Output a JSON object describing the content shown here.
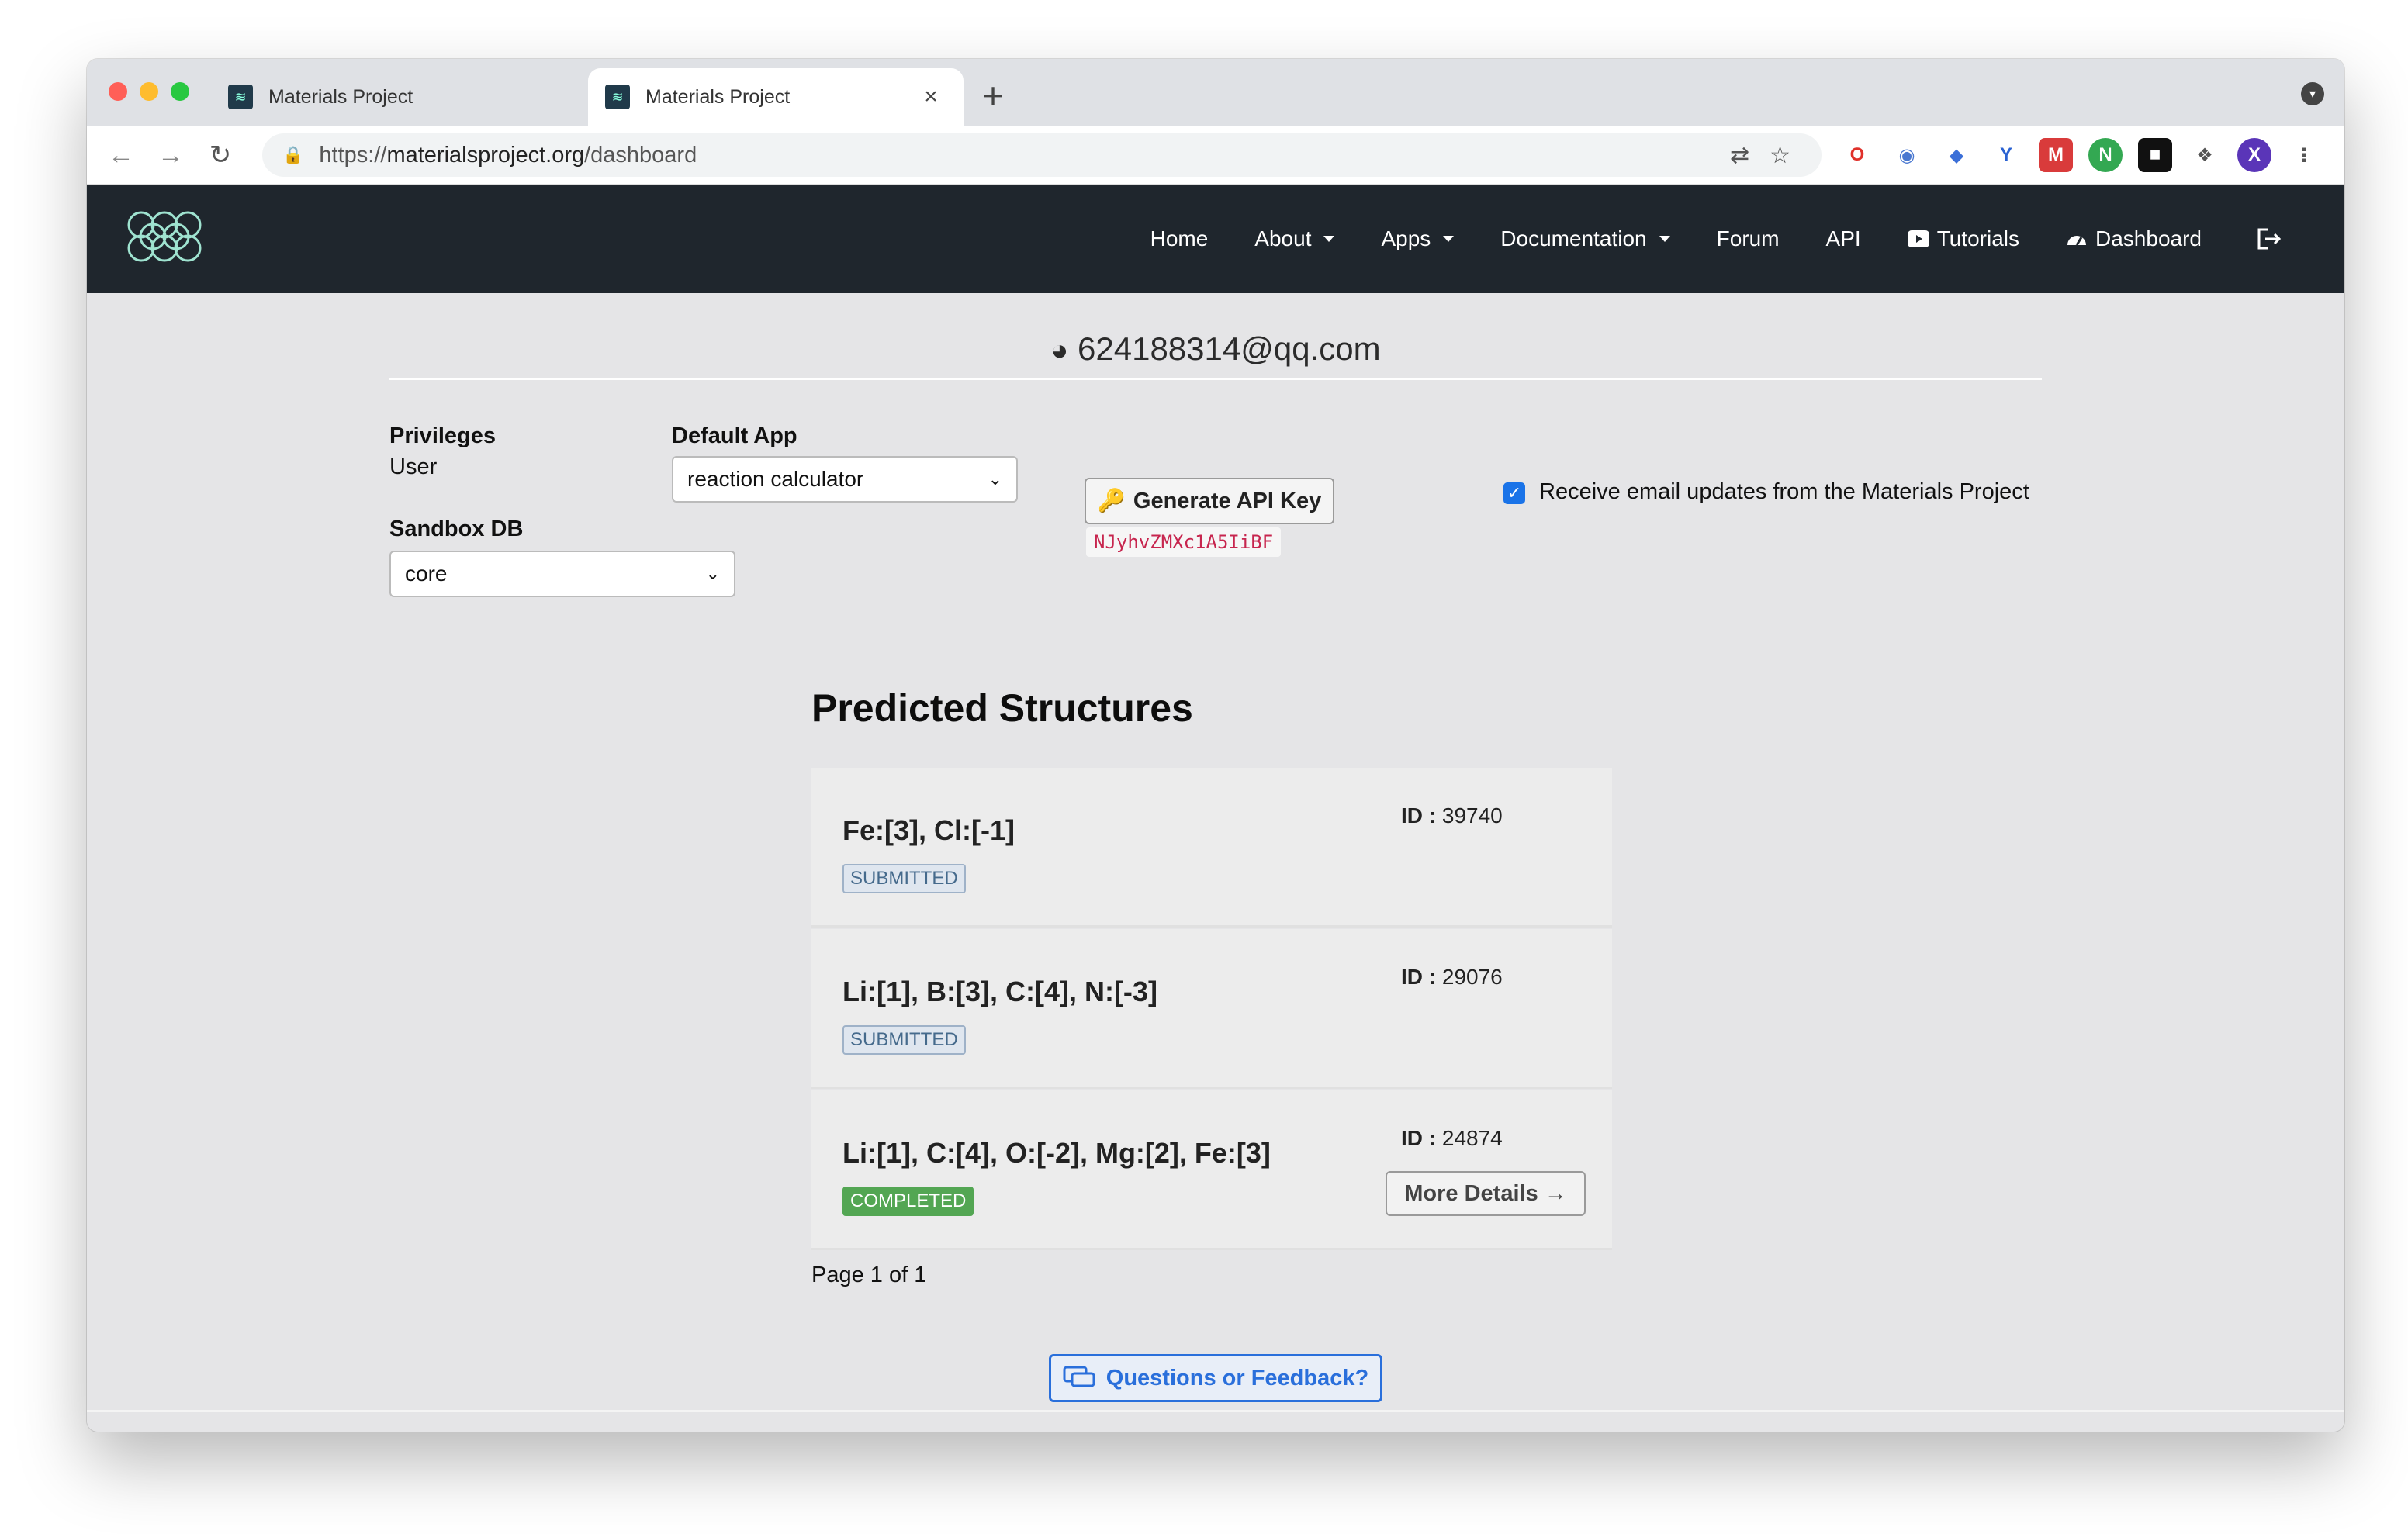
{
  "browser": {
    "tabs": [
      {
        "title": "Materials Project",
        "active": false
      },
      {
        "title": "Materials Project",
        "active": true
      }
    ],
    "url_scheme": "https://",
    "url_host": "materialsproject.org",
    "url_path": "/dashboard",
    "profile_initial": "X"
  },
  "nav": {
    "items": [
      {
        "label": "Home"
      },
      {
        "label": "About",
        "dropdown": true
      },
      {
        "label": "Apps",
        "dropdown": true
      },
      {
        "label": "Documentation",
        "dropdown": true
      },
      {
        "label": "Forum"
      },
      {
        "label": "API"
      },
      {
        "label": "Tutorials",
        "icon": "youtube-icon"
      },
      {
        "label": "Dashboard",
        "icon": "dashboard-icon"
      }
    ]
  },
  "dashboard": {
    "email": "624188314@qq.com",
    "privileges_label": "Privileges",
    "privileges_value": "User",
    "default_app_label": "Default App",
    "default_app_value": "reaction calculator",
    "sandbox_label": "Sandbox DB",
    "sandbox_value": "core",
    "generate_key_label": "Generate API Key",
    "api_key": "NJyhvZMXc1A5IiBF",
    "email_updates_label": "Receive email updates from the Materials Project",
    "email_updates_checked": true
  },
  "predicted": {
    "title": "Predicted Structures",
    "items": [
      {
        "formula": "Fe:[3], Cl:[-1]",
        "status": "SUBMITTED",
        "id_label": "ID :",
        "id": "39740"
      },
      {
        "formula": "Li:[1], B:[3], C:[4], N:[-3]",
        "status": "SUBMITTED",
        "id_label": "ID :",
        "id": "29076"
      },
      {
        "formula": "Li:[1], C:[4], O:[-2], Mg:[2], Fe:[3]",
        "status": "COMPLETED",
        "id_label": "ID :",
        "id": "24874",
        "more": "More Details →"
      }
    ],
    "page_info": "Page 1 of 1"
  },
  "feedback_label": "Questions or Feedback?",
  "colors": {
    "navbar": "#1f262d",
    "accent": "#2a6fdb",
    "completed": "#53a653"
  }
}
